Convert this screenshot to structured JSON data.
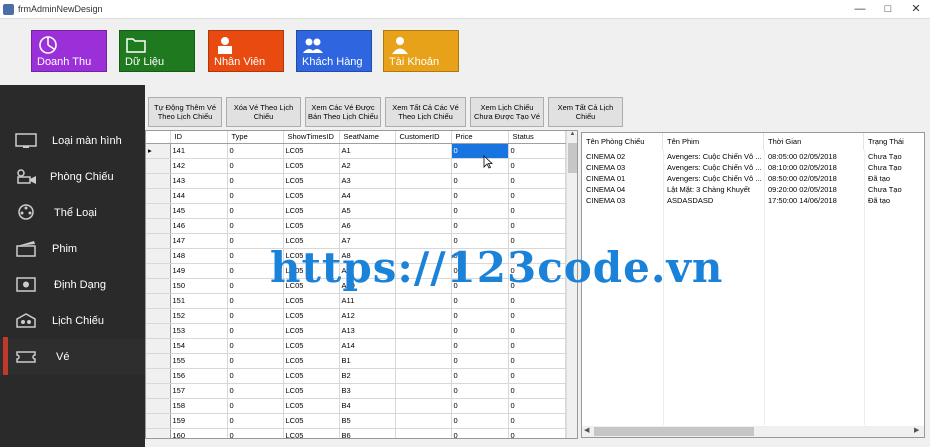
{
  "window": {
    "title": "frmAdminNewDesign",
    "minimize": "—",
    "maximize": "□",
    "close": "✕"
  },
  "tiles": [
    {
      "label": "Doanh Thu",
      "color": "#9b30d9",
      "icon": "chart-pie-icon"
    },
    {
      "label": "Dữ Liệu",
      "color": "#1f7a1f",
      "icon": "folder-icon"
    },
    {
      "label": "Nhân Viên",
      "color": "#e84a0f",
      "icon": "employee-icon"
    },
    {
      "label": "Khách Hàng",
      "color": "#2f66e0",
      "icon": "customers-icon"
    },
    {
      "label": "Tài Khoản",
      "color": "#e8a21a",
      "icon": "account-icon"
    }
  ],
  "sidebar": {
    "items": [
      {
        "label": "Loại màn hình",
        "icon": "monitor-icon"
      },
      {
        "label": "Phòng Chiếu",
        "icon": "projector-icon"
      },
      {
        "label": "Thể Loại",
        "icon": "film-reel-icon"
      },
      {
        "label": "Phim",
        "icon": "clapperboard-icon"
      },
      {
        "label": "Định Dạng",
        "icon": "format-icon"
      },
      {
        "label": "Lịch Chiếu",
        "icon": "schedule-icon"
      },
      {
        "label": "Vé",
        "icon": "ticket-icon"
      }
    ],
    "active_index": 6,
    "accent": "#c0392b"
  },
  "toolbar": {
    "buttons": [
      {
        "line1": "Tự Động Thêm Vé",
        "line2": "Theo Lịch Chiếu"
      },
      {
        "line1": "Xóa Vé Theo Lịch",
        "line2": "Chiếu"
      },
      {
        "line1": "Xem Các Vé Được",
        "line2": "Bán Theo Lịch Chiếu"
      },
      {
        "line1": "Xem Tất Cả Các Vé",
        "line2": "Theo Lịch Chiếu"
      },
      {
        "line1": "Xem Lịch Chiếu",
        "line2": "Chưa Được Tạo Vé"
      },
      {
        "line1": "Xem Tất Cả Lịch",
        "line2": "Chiếu"
      }
    ]
  },
  "grid": {
    "columns": [
      "ID",
      "Type",
      "ShowTimesID",
      "SeatName",
      "CustomerID",
      "Price",
      "Status"
    ],
    "rows": [
      [
        "141",
        "0",
        "LC05",
        "A1",
        "",
        "0",
        "0"
      ],
      [
        "142",
        "0",
        "LC05",
        "A2",
        "",
        "0",
        "0"
      ],
      [
        "143",
        "0",
        "LC05",
        "A3",
        "",
        "0",
        "0"
      ],
      [
        "144",
        "0",
        "LC05",
        "A4",
        "",
        "0",
        "0"
      ],
      [
        "145",
        "0",
        "LC05",
        "A5",
        "",
        "0",
        "0"
      ],
      [
        "146",
        "0",
        "LC05",
        "A6",
        "",
        "0",
        "0"
      ],
      [
        "147",
        "0",
        "LC05",
        "A7",
        "",
        "0",
        "0"
      ],
      [
        "148",
        "0",
        "LC05",
        "A8",
        "",
        "0",
        "0"
      ],
      [
        "149",
        "0",
        "LC05",
        "A9",
        "",
        "0",
        "0"
      ],
      [
        "150",
        "0",
        "LC05",
        "A10",
        "",
        "0",
        "0"
      ],
      [
        "151",
        "0",
        "LC05",
        "A11",
        "",
        "0",
        "0"
      ],
      [
        "152",
        "0",
        "LC05",
        "A12",
        "",
        "0",
        "0"
      ],
      [
        "153",
        "0",
        "LC05",
        "A13",
        "",
        "0",
        "0"
      ],
      [
        "154",
        "0",
        "LC05",
        "A14",
        "",
        "0",
        "0"
      ],
      [
        "155",
        "0",
        "LC05",
        "B1",
        "",
        "0",
        "0"
      ],
      [
        "156",
        "0",
        "LC05",
        "B2",
        "",
        "0",
        "0"
      ],
      [
        "157",
        "0",
        "LC05",
        "B3",
        "",
        "0",
        "0"
      ],
      [
        "158",
        "0",
        "LC05",
        "B4",
        "",
        "0",
        "0"
      ],
      [
        "159",
        "0",
        "LC05",
        "B5",
        "",
        "0",
        "0"
      ],
      [
        "160",
        "0",
        "LC05",
        "B6",
        "",
        "0",
        "0"
      ]
    ],
    "selected_row": 0,
    "selected_col": 5,
    "current_row_marker": "▸"
  },
  "showtimes": {
    "columns": [
      "Tên Phòng Chiếu",
      "Tên Phim",
      "Thời Gian",
      "Trạng Thái"
    ],
    "rows": [
      [
        "CINEMA 02",
        "Avengers: Cuộc Chiến Vô ...",
        "08:05:00 02/05/2018",
        "Chưa Tạo"
      ],
      [
        "CINEMA 03",
        "Avengers: Cuộc Chiến Vô ...",
        "08:10:00 02/05/2018",
        "Chưa Tạo"
      ],
      [
        "CINEMA 01",
        "Avengers: Cuộc Chiến Vô ...",
        "08:50:00 02/05/2018",
        "Đã tạo"
      ],
      [
        "CINEMA 04",
        "Lật Mặt: 3 Chàng Khuyết",
        "09:20:00 02/05/2018",
        "Chưa Tạo"
      ],
      [
        "CINEMA 03",
        "ASDASDASD",
        "17:50:00 14/06/2018",
        "Đã tạo"
      ]
    ]
  },
  "watermark": "https://123code.vn"
}
